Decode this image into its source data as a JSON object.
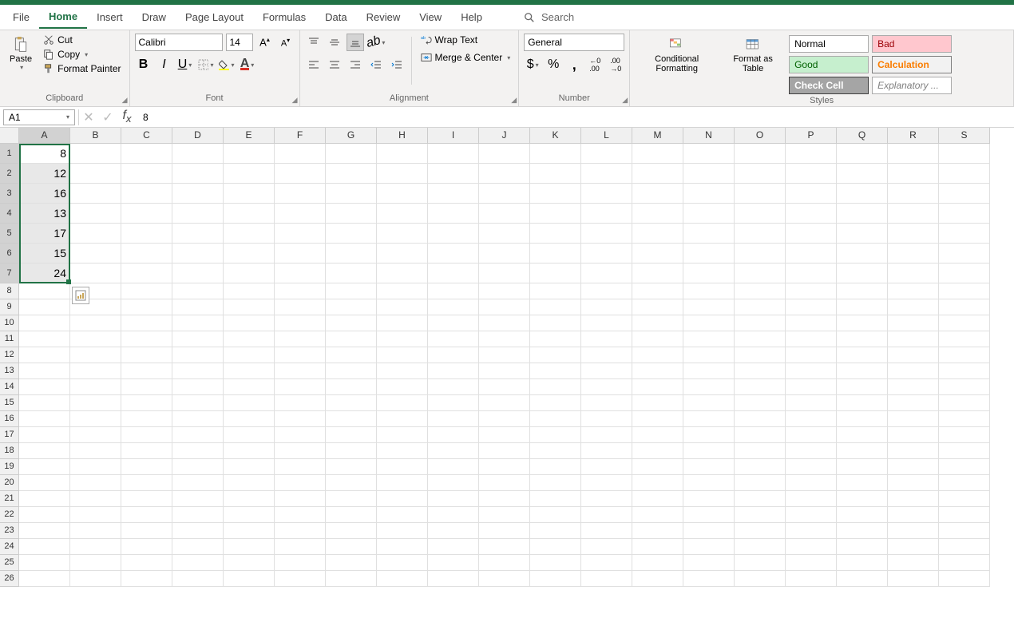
{
  "tabs": [
    "File",
    "Home",
    "Insert",
    "Draw",
    "Page Layout",
    "Formulas",
    "Data",
    "Review",
    "View",
    "Help"
  ],
  "active_tab": "Home",
  "search_placeholder": "Search",
  "clipboard": {
    "paste": "Paste",
    "cut": "Cut",
    "copy": "Copy",
    "painter": "Format Painter",
    "label": "Clipboard"
  },
  "font": {
    "name": "Calibri",
    "size": "14",
    "label": "Font"
  },
  "alignment": {
    "wrap": "Wrap Text",
    "merge": "Merge & Center",
    "label": "Alignment"
  },
  "number": {
    "format": "General",
    "label": "Number"
  },
  "styles": {
    "cond": "Conditional Formatting",
    "table": "Format as Table",
    "normal": "Normal",
    "bad": "Bad",
    "good": "Good",
    "calc": "Calculation",
    "check": "Check Cell",
    "explan": "Explanatory ...",
    "label": "Styles"
  },
  "namebox": "A1",
  "formula": "8",
  "columns": [
    "A",
    "B",
    "C",
    "D",
    "E",
    "F",
    "G",
    "H",
    "I",
    "J",
    "K",
    "L",
    "M",
    "N",
    "O",
    "P",
    "Q",
    "R",
    "S"
  ],
  "cells": {
    "A1": "8",
    "A2": "12",
    "A3": "16",
    "A4": "13",
    "A5": "17",
    "A6": "15",
    "A7": "24"
  },
  "row_count": 26,
  "selected_col": "A",
  "selected_rows": [
    1,
    2,
    3,
    4,
    5,
    6,
    7
  ]
}
